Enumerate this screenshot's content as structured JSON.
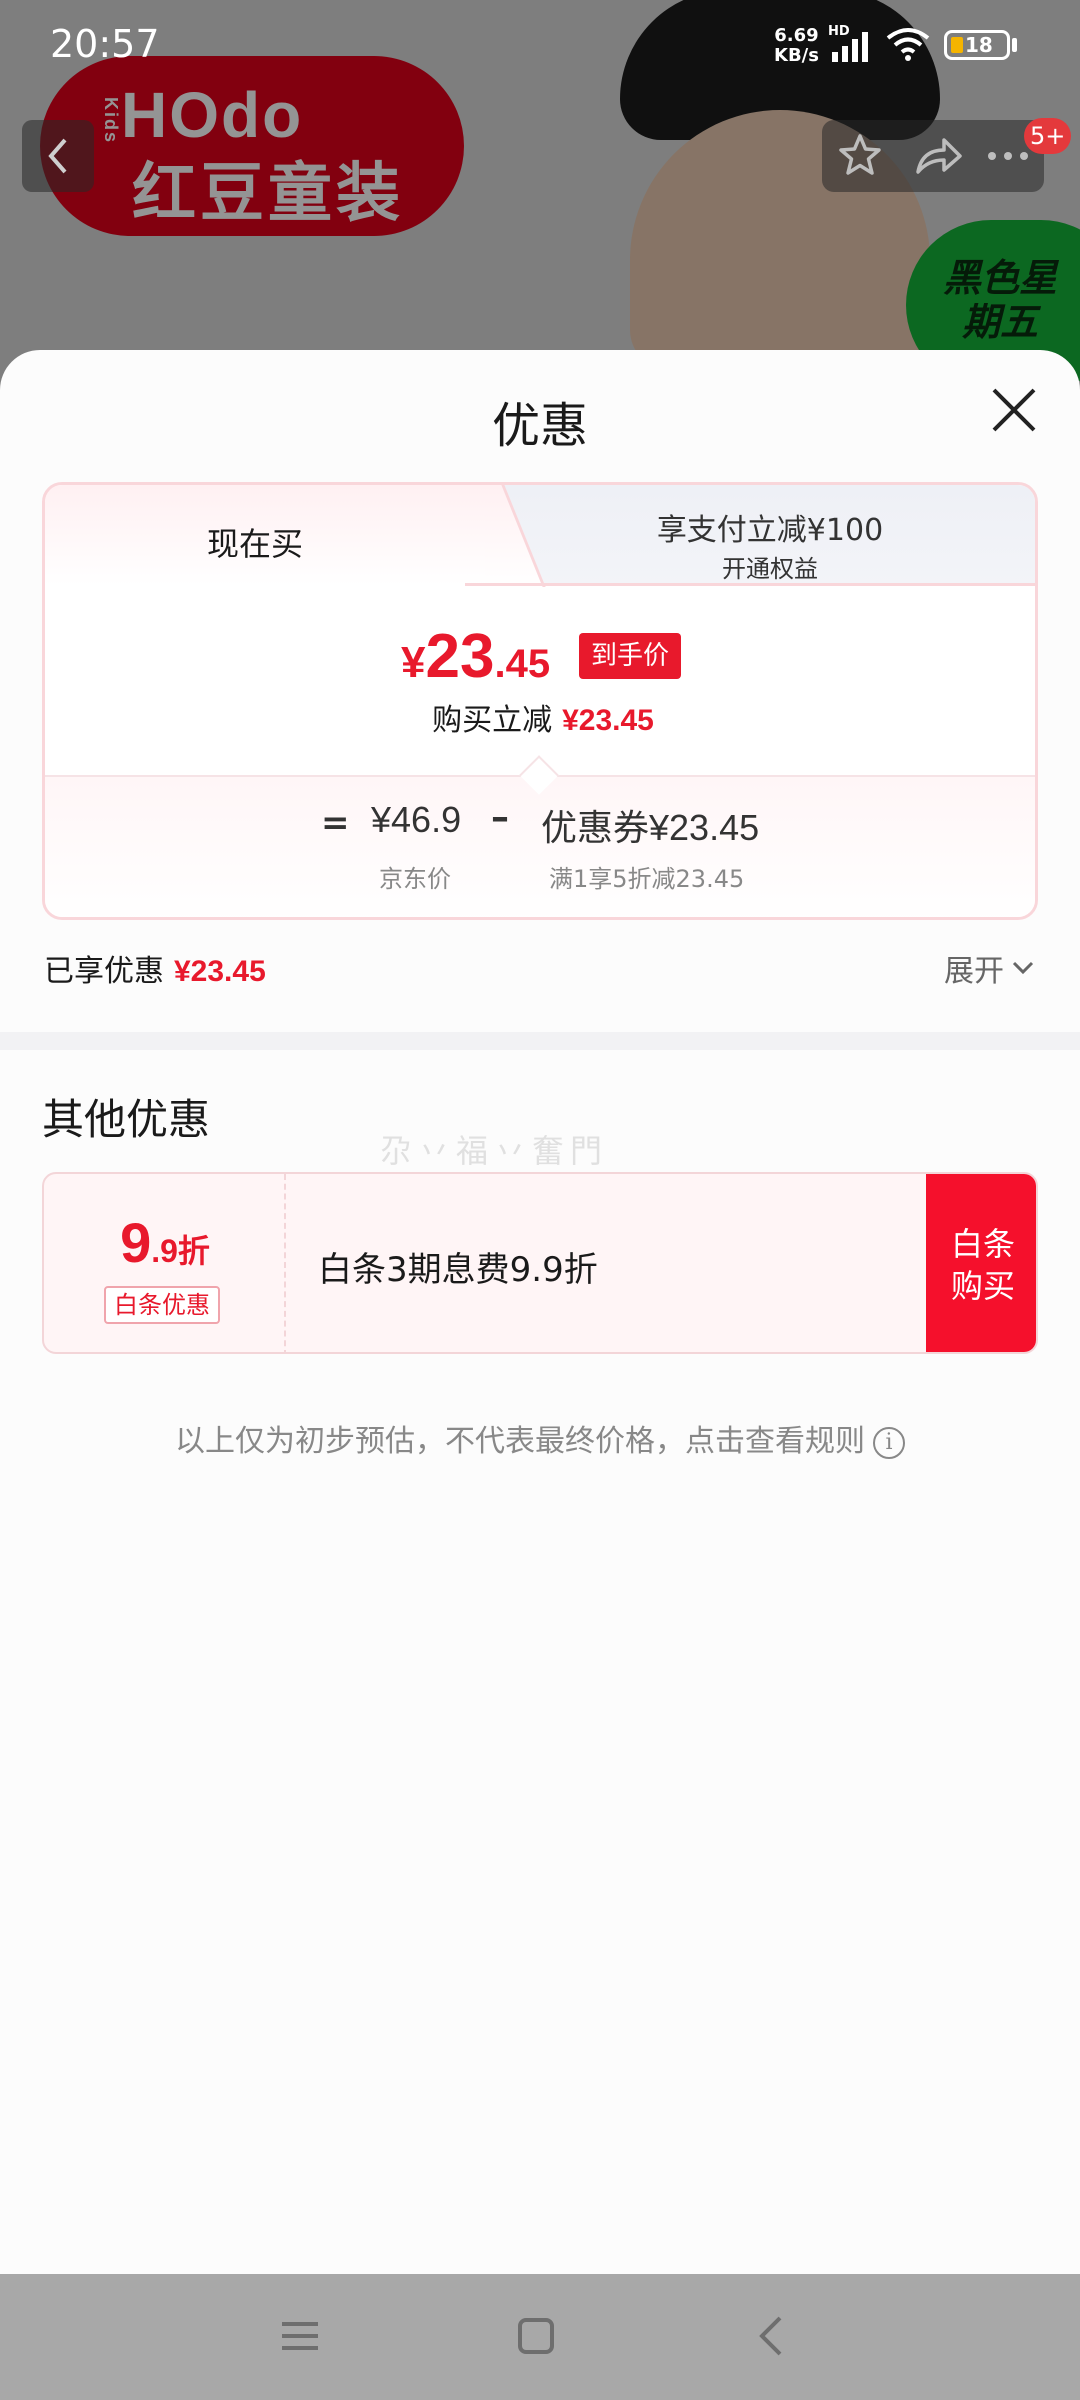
{
  "status_bar": {
    "time": "20:57",
    "net_speed_value": "6.69",
    "net_speed_unit": "KB/s",
    "hd_label": "HD",
    "battery": "18"
  },
  "header": {
    "brand_logo_text": "HOdo",
    "brand_logo_kids": "Kids",
    "brand_logo_cn": "红豆童装",
    "promo_badge": "黑色星期五",
    "cart_badge": "5+"
  },
  "sheet": {
    "title": "优惠",
    "tabs": [
      {
        "label": "现在买",
        "active": true
      },
      {
        "label": "享支付立减¥100",
        "sub": "开通权益",
        "active": false
      }
    ],
    "final_price": {
      "yen": "¥",
      "int": "23",
      "dec": ".45",
      "badge": "到手价"
    },
    "reduce": {
      "label": "购买立减",
      "value": "¥23.45"
    },
    "breakdown": {
      "equals": "=",
      "jd_price": "¥46.9",
      "jd_label": "京东价",
      "minus": "–",
      "coupon_label": "优惠券",
      "coupon_value": "¥23.45",
      "coupon_desc": "满1享5折减23.45"
    },
    "enjoyed": {
      "label": "已享优惠",
      "value": "¥23.45"
    },
    "expand_label": "展开",
    "other": {
      "title": "其他优惠",
      "watermark": "尕丷福丷奮門",
      "baitiao": {
        "discount_big": "9",
        "discount_small": ".9折",
        "tag": "白条优惠",
        "text": "白条3期息费9.9折",
        "buy_line1": "白条",
        "buy_line2": "购买"
      }
    },
    "disclaimer": "以上仅为初步预估，不代表最终价格，点击查看规则",
    "info_icon_glyph": "i"
  },
  "colors": {
    "accent_red": "#e8192c",
    "buy_red": "#f5102c",
    "card_border": "#f9d6da"
  }
}
